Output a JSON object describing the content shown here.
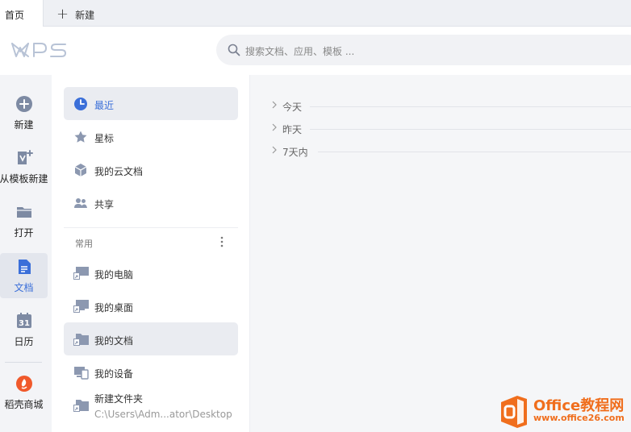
{
  "tabs": {
    "home": "首页",
    "new_tab": "新建"
  },
  "header": {
    "logo": "WPS",
    "search_placeholder": "搜索文档、应用、模板 ..."
  },
  "rail": {
    "items": [
      {
        "label": "新建",
        "icon": "plus-circle-icon"
      },
      {
        "label": "从模板新建",
        "icon": "template-icon"
      },
      {
        "label": "打开",
        "icon": "folder-icon"
      },
      {
        "label": "文档",
        "icon": "document-icon",
        "active": true
      },
      {
        "label": "日历",
        "icon": "calendar-icon",
        "day": "31"
      },
      {
        "label": "稻壳商城",
        "icon": "docer-icon"
      }
    ]
  },
  "nav": {
    "items": [
      {
        "label": "最近",
        "icon": "clock-icon",
        "active": true
      },
      {
        "label": "星标",
        "icon": "star-icon"
      },
      {
        "label": "我的云文档",
        "icon": "cloud-doc-icon"
      },
      {
        "label": "共享",
        "icon": "share-users-icon"
      }
    ],
    "section_title": "常用",
    "common": [
      {
        "label": "我的电脑",
        "icon": "computer-shortcut-icon"
      },
      {
        "label": "我的桌面",
        "icon": "desktop-shortcut-icon"
      },
      {
        "label": "我的文档",
        "icon": "folder-shortcut-icon"
      },
      {
        "label": "我的设备",
        "icon": "devices-icon"
      },
      {
        "label": "新建文件夹",
        "sub": "C:\\Users\\Adm...ator\\Desktop",
        "icon": "folder-shortcut-icon"
      }
    ]
  },
  "main": {
    "groups": [
      "今天",
      "昨天",
      "7天内"
    ]
  },
  "watermark": {
    "line1": "Office教程网",
    "line2": "www.office26.com"
  },
  "colors": {
    "accent": "#3b6fd9",
    "docer": "#f0592b",
    "watermark": "#f06e1d"
  }
}
